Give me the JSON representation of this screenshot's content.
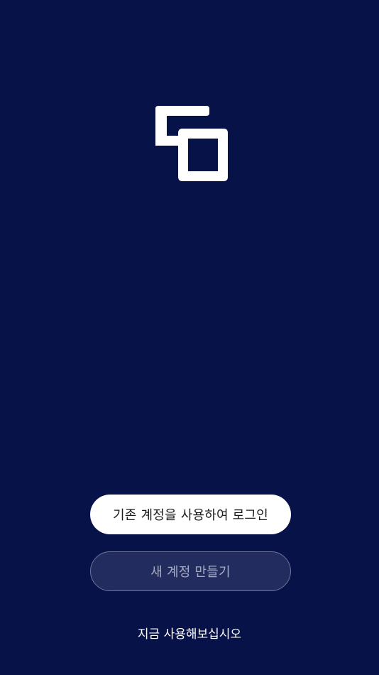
{
  "welcome": {
    "logo_icon": "brand-logo-icon",
    "login_button_label": "기존 계정을 사용하여 로그인",
    "signup_button_label": "새 계정 만들기",
    "try_now_label": "지금 사용해보십시오"
  },
  "colors": {
    "background": "#061248",
    "logo": "#ffffff",
    "login_button_bg": "#ffffff",
    "signup_button_bg": "#232c5e",
    "signup_button_text": "#a6abc4"
  }
}
